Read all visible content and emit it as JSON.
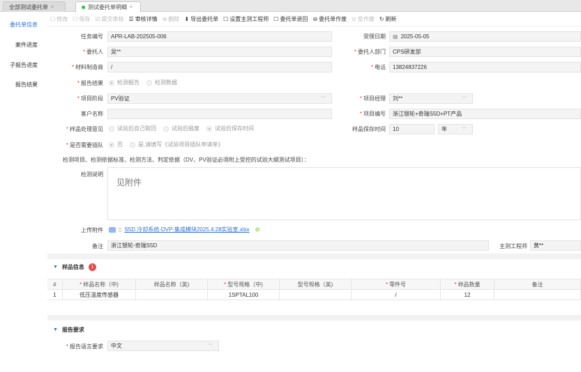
{
  "tabs": [
    {
      "label": "全部测试委托单",
      "close": "×"
    },
    {
      "label": "测试委托单明细",
      "close": "×"
    }
  ],
  "leftnav": [
    "委托单信息",
    "案件进度",
    "子报告进度",
    "报告结果"
  ],
  "toolbar": [
    {
      "icon": "☐",
      "label": "修改",
      "disabled": true
    },
    {
      "icon": "☐",
      "label": "保存",
      "disabled": true
    },
    {
      "icon": "☑",
      "label": "提交审核",
      "disabled": true
    },
    {
      "icon": "☰",
      "label": "审核详情",
      "disabled": false
    },
    {
      "icon": "⊖",
      "label": "删除",
      "disabled": true
    },
    {
      "icon": "⬇",
      "label": "导出委托单",
      "disabled": false
    },
    {
      "icon": "☐",
      "label": "设置主测工程师",
      "disabled": false
    },
    {
      "icon": "☐",
      "label": "委托单退回",
      "disabled": false
    },
    {
      "icon": "⊖",
      "label": "委托单作废",
      "disabled": false
    },
    {
      "icon": "⊙",
      "label": "反作废",
      "disabled": true
    },
    {
      "icon": "↻",
      "label": "刷新",
      "disabled": false
    }
  ],
  "form": {
    "task_no_label": "任务编号",
    "task_no": "APR-LAB-202505-006",
    "accept_date_label": "受理日期",
    "accept_date": "2025-05-05",
    "client_label": "委托人",
    "client": "吴**",
    "client_dept_label": "委托人部门",
    "client_dept": "CPS研发部",
    "material_mfr_label": "材料制造商",
    "material_mfr": "/",
    "phone_label": "电话",
    "phone": "13824837226",
    "report_result_label": "报告结果",
    "report_opt1": "检测报告",
    "report_opt2": "检测数据",
    "project_stage_label": "项目阶段",
    "project_stage": "PV验证",
    "project_mgr_label": "项目经理",
    "project_mgr": "刘**",
    "customer_label": "客户名称",
    "customer": "",
    "project_no_label": "项目编号",
    "project_no": "浙江银轮+奇瑞S5D+PT产品",
    "sample_handle_label": "样品处理意见",
    "sample_opt1": "试验后自己取回",
    "sample_opt2": "试验后报废",
    "sample_opt3": "试验后保存时间",
    "sample_keep_label": "样品保存时间",
    "sample_keep": "10",
    "sample_keep_unit": "年",
    "insert_label": "是否需要插队",
    "insert_opt1": "否",
    "insert_opt2": "是,请填写《试验项目插队申请单》",
    "test_items_note": "检测项目、检测依据标准、检测方法、判定依据（DV、PV验证必须附上受控的试验大纲测试项目）：",
    "test_desc_label": "检测说明",
    "test_desc": "见附件",
    "upload_label": "上传附件",
    "upload_file": "S5D 冷却系统-DVP-集成模块2025.4.28实验室.xlsx",
    "remark_label": "备注",
    "remark": "浙江银轮-奇瑞S5D",
    "engineer_label": "主测工程师",
    "engineer": "黄**"
  },
  "sample": {
    "title": "样品信息",
    "badge": "1",
    "headers": [
      "#",
      "样品名称（中)",
      "样品名称（英)",
      "型号规格（中)",
      "型号规格（英)",
      "零件号",
      "样品数量",
      "备注"
    ],
    "rows": [
      [
        "1",
        "低压温度传感器",
        "",
        "1SPTAL100",
        "",
        "/",
        "12",
        ""
      ]
    ]
  },
  "report_req": {
    "title": "报告要求",
    "lang_label": "报告语言要求",
    "lang": "中文"
  }
}
